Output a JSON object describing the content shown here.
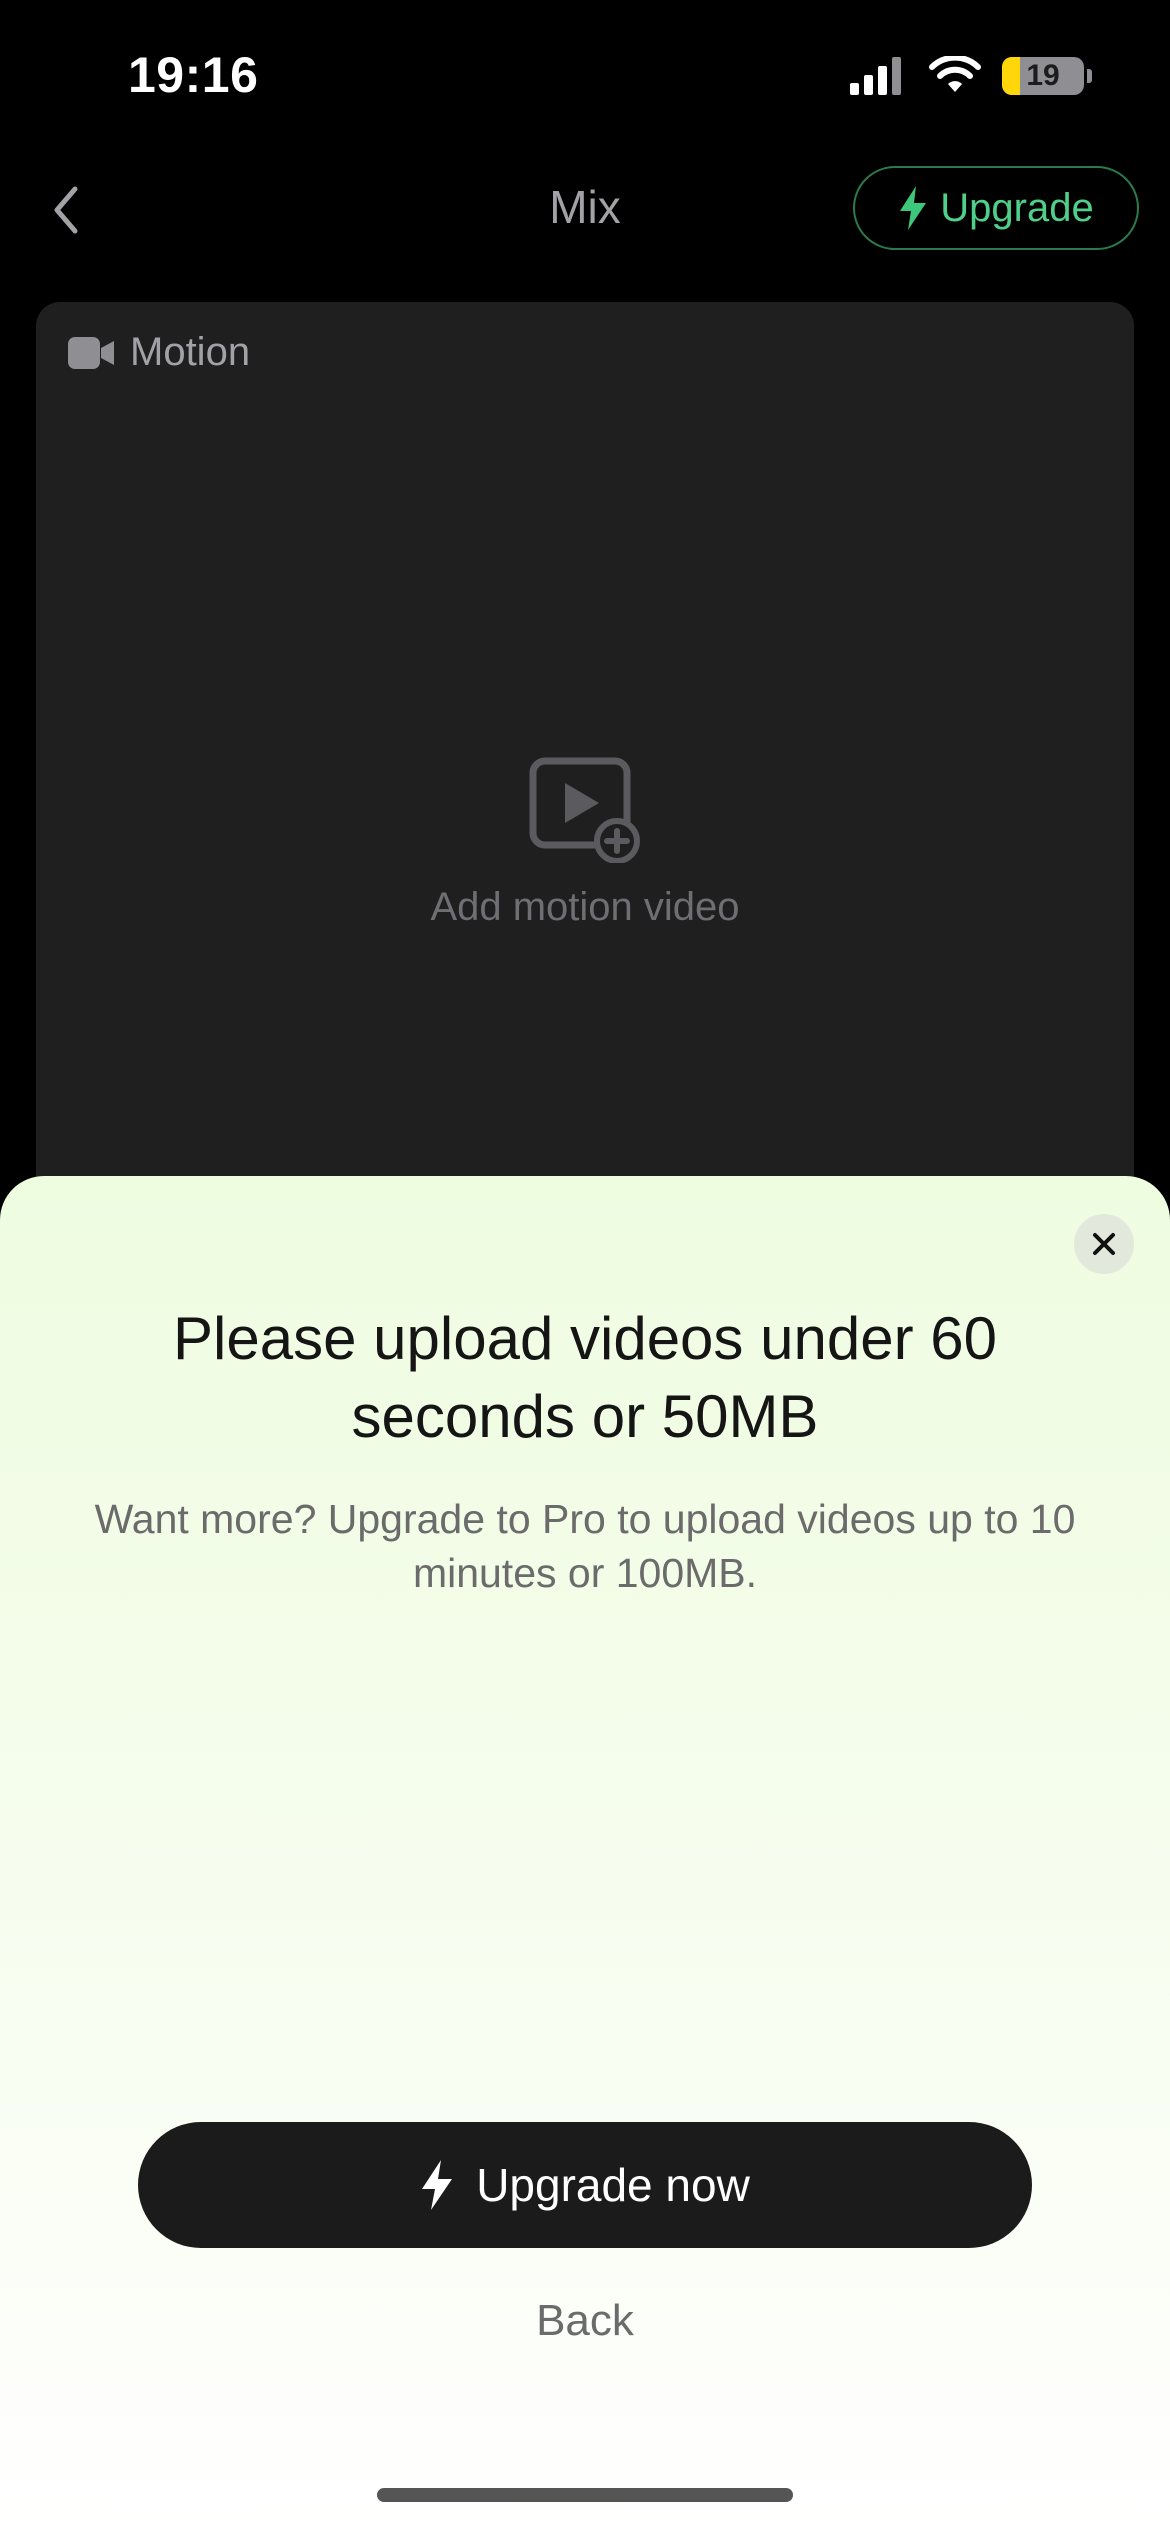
{
  "status_bar": {
    "time": "19:16",
    "battery_level": "19",
    "icons": [
      "cellular-signal-icon",
      "wifi-icon",
      "battery-icon"
    ]
  },
  "nav": {
    "title": "Mix",
    "upgrade_label": "Upgrade",
    "icons": [
      "back-chevron-icon",
      "bolt-icon"
    ]
  },
  "motion_card": {
    "header_label": "Motion",
    "add_label": "Add motion video",
    "icons": [
      "video-camera-icon",
      "video-add-icon"
    ]
  },
  "sheet": {
    "title": "Please upload videos under 60 seconds or 50MB",
    "subtitle": "Want more? Upgrade to Pro to upload videos up to 10 minutes or 100MB.",
    "primary_button_label": "Upgrade now",
    "secondary_label": "Back",
    "icons": [
      "close-icon",
      "bolt-icon"
    ]
  },
  "colors": {
    "background": "#000000",
    "card": "#1f1f1f",
    "accent_green": "#4fd08a",
    "sheet_top": "#eefce0",
    "primary_button": "#1b1b1b"
  }
}
